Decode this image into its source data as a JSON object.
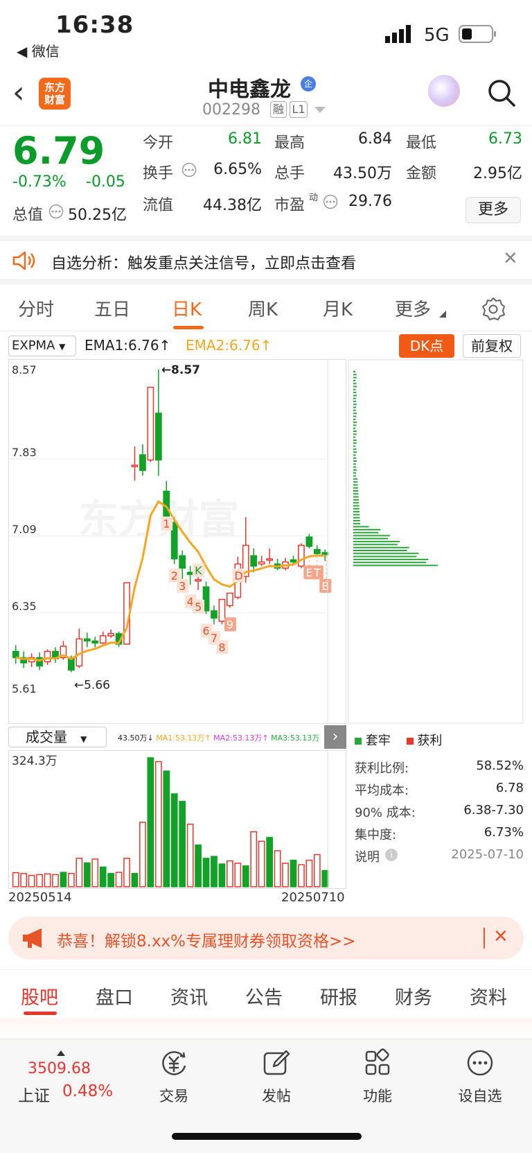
{
  "status_bar": {
    "time": "16:38",
    "back_app": "◀ 微信",
    "network": "5G"
  },
  "header": {
    "name": "中电鑫龙",
    "badge": "企",
    "code": "002298",
    "tag1": "融",
    "tag2": "L1",
    "logo_line1": "东方",
    "logo_line2": "财富"
  },
  "quote": {
    "price": "6.79",
    "pct": "-0.73%",
    "change": "-0.05",
    "total_label": "总值",
    "total_value": "50.25亿",
    "fields": [
      {
        "label": "今开",
        "value": "6.81",
        "color": "#0a9b2a"
      },
      {
        "label": "最高",
        "value": "6.84",
        "color": "#222"
      },
      {
        "label": "最低",
        "value": "6.73",
        "color": "#0a9b2a"
      },
      {
        "label": "换手",
        "value": "6.65%",
        "color": "#222"
      },
      {
        "label": "总手",
        "value": "43.50万",
        "color": "#222"
      },
      {
        "label": "金额",
        "value": "2.95亿",
        "color": "#222"
      },
      {
        "label": "流值",
        "value": "44.38亿",
        "color": "#222"
      },
      {
        "label": "市盈",
        "value": "29.76",
        "color": "#222"
      }
    ],
    "pe_sup": "动",
    "more": "更多"
  },
  "banner": {
    "text": "自选分析：触发重点关注信号，立即点击查看"
  },
  "chart_tabs": [
    "分时",
    "五日",
    "日K",
    "周K",
    "月K",
    "更多"
  ],
  "indicator": {
    "select": "EXPMA",
    "ema1": "EMA1:6.76↑",
    "ema2": "EMA2:6.76↑",
    "dk": "DK点",
    "fq": "前复权"
  },
  "chart_data": {
    "type": "candlestick",
    "ylim": [
      5.61,
      8.57
    ],
    "y_ticks": [
      "8.57",
      "7.83",
      "7.09",
      "6.35",
      "5.61"
    ],
    "high_label": "←8.57",
    "low_label": "←5.66",
    "watermark": "东方财富",
    "candles": [
      {
        "o": 5.86,
        "c": 5.8,
        "h": 5.92,
        "l": 5.74
      },
      {
        "o": 5.8,
        "c": 5.75,
        "h": 5.86,
        "l": 5.7
      },
      {
        "o": 5.76,
        "c": 5.8,
        "h": 5.84,
        "l": 5.71
      },
      {
        "o": 5.8,
        "c": 5.72,
        "h": 5.85,
        "l": 5.68
      },
      {
        "o": 5.76,
        "c": 5.86,
        "h": 5.88,
        "l": 5.73
      },
      {
        "o": 5.86,
        "c": 5.79,
        "h": 5.9,
        "l": 5.75
      },
      {
        "o": 5.8,
        "c": 5.91,
        "h": 5.96,
        "l": 5.78
      },
      {
        "o": 5.8,
        "c": 5.68,
        "h": 5.82,
        "l": 5.66
      },
      {
        "o": 5.72,
        "c": 5.98,
        "h": 6.08,
        "l": 5.7
      },
      {
        "o": 5.98,
        "c": 5.96,
        "h": 6.04,
        "l": 5.9
      },
      {
        "o": 5.96,
        "c": 5.94,
        "h": 6.0,
        "l": 5.9
      },
      {
        "o": 5.94,
        "c": 6.01,
        "h": 6.05,
        "l": 5.93
      },
      {
        "o": 6.01,
        "c": 6.03,
        "h": 6.07,
        "l": 5.99
      },
      {
        "o": 6.03,
        "c": 5.93,
        "h": 6.05,
        "l": 5.9
      },
      {
        "o": 5.93,
        "c": 6.52,
        "h": 6.52,
        "l": 5.93
      },
      {
        "o": 7.65,
        "c": 7.65,
        "h": 7.83,
        "l": 7.5
      },
      {
        "o": 7.75,
        "c": 7.6,
        "h": 7.85,
        "l": 7.55
      },
      {
        "o": 7.7,
        "c": 8.4,
        "h": 8.4,
        "l": 7.68
      },
      {
        "o": 8.15,
        "c": 7.7,
        "h": 8.57,
        "l": 7.55
      },
      {
        "o": 7.4,
        "c": 7.1,
        "h": 7.5,
        "l": 7.05
      },
      {
        "o": 7.1,
        "c": 6.75,
        "h": 7.15,
        "l": 6.7
      },
      {
        "o": 6.78,
        "c": 6.66,
        "h": 6.83,
        "l": 6.54
      },
      {
        "o": 6.62,
        "c": 6.6,
        "h": 6.68,
        "l": 6.5
      },
      {
        "o": 6.55,
        "c": 6.55,
        "h": 6.62,
        "l": 6.45
      },
      {
        "o": 6.48,
        "c": 6.25,
        "h": 6.53,
        "l": 6.22
      },
      {
        "o": 6.25,
        "c": 6.18,
        "h": 6.3,
        "l": 6.12
      },
      {
        "o": 6.15,
        "c": 6.36,
        "h": 6.36,
        "l": 6.12
      },
      {
        "o": 6.3,
        "c": 6.42,
        "h": 6.42,
        "l": 6.28
      },
      {
        "o": 6.38,
        "c": 6.7,
        "h": 6.77,
        "l": 6.36
      },
      {
        "o": 6.58,
        "c": 6.88,
        "h": 7.15,
        "l": 6.52
      },
      {
        "o": 6.78,
        "c": 6.68,
        "h": 6.85,
        "l": 6.62
      },
      {
        "o": 6.7,
        "c": 6.72,
        "h": 6.78,
        "l": 6.68
      },
      {
        "o": 6.75,
        "c": 6.75,
        "h": 6.85,
        "l": 6.7
      },
      {
        "o": 6.7,
        "c": 6.66,
        "h": 6.75,
        "l": 6.64
      },
      {
        "o": 6.66,
        "c": 6.72,
        "h": 6.76,
        "l": 6.64
      },
      {
        "o": 6.74,
        "c": 6.72,
        "h": 6.78,
        "l": 6.69
      },
      {
        "o": 6.68,
        "c": 6.88,
        "h": 6.9,
        "l": 6.66
      },
      {
        "o": 6.96,
        "c": 6.87,
        "h": 6.99,
        "l": 6.85
      },
      {
        "o": 6.84,
        "c": 6.8,
        "h": 6.88,
        "l": 6.78
      },
      {
        "o": 6.81,
        "c": 6.79,
        "h": 6.84,
        "l": 6.73
      }
    ],
    "markers": [
      "1",
      "2",
      "3",
      "4",
      "5",
      "6",
      "7",
      "8",
      "9",
      "D",
      "K",
      "E",
      "T",
      "B"
    ],
    "volume": {
      "max_label": "324.3万",
      "values": [
        37,
        35,
        30,
        32,
        34,
        32,
        38,
        35,
        75,
        63,
        73,
        52,
        35,
        38,
        75,
        35,
        170,
        340,
        330,
        305,
        245,
        225,
        165,
        110,
        75,
        80,
        60,
        68,
        62,
        55,
        145,
        120,
        130,
        95,
        62,
        70,
        58,
        70,
        85,
        43
      ],
      "colors": [
        "r",
        "r",
        "r",
        "r",
        "r",
        "r",
        "g",
        "r",
        "r",
        "g",
        "r",
        "g",
        "g",
        "r",
        "r",
        "g",
        "r",
        "g",
        "r",
        "g",
        "g",
        "g",
        "r",
        "g",
        "g",
        "g",
        "g",
        "r",
        "r",
        "g",
        "r",
        "r",
        "g",
        "r",
        "r",
        "g",
        "r",
        "r",
        "r",
        "g"
      ]
    },
    "date_start": "20250514",
    "date_end": "20250710"
  },
  "volume_header": {
    "select": "成交量",
    "vol": "43.50万↓",
    "ma1": "MA1:53.13万↑",
    "ma2": "MA2:53.13万↑",
    "ma3": "MA3:53.13万"
  },
  "distribution": {
    "legend_lock": "套牢",
    "legend_profit": "获利",
    "stats": [
      {
        "label": "获利比例:",
        "value": "58.52%"
      },
      {
        "label": "平均成本:",
        "value": "6.78"
      },
      {
        "label": "90% 成本:",
        "value": "6.38-7.30"
      },
      {
        "label": "集中度:",
        "value": "6.73%"
      }
    ],
    "note_label": "说明",
    "note_date": "2025-07-10"
  },
  "promo": {
    "text": "恭喜！解锁8.xx%专属理财券领取资格>>"
  },
  "info_tabs": [
    "股吧",
    "盘口",
    "资讯",
    "公告",
    "研报",
    "财务",
    "资料"
  ],
  "bottom_nav": {
    "index_value": "3509.68",
    "index_name": "上证",
    "index_pct": "0.48%",
    "items": [
      "交易",
      "发帖",
      "功能",
      "设自选"
    ]
  }
}
